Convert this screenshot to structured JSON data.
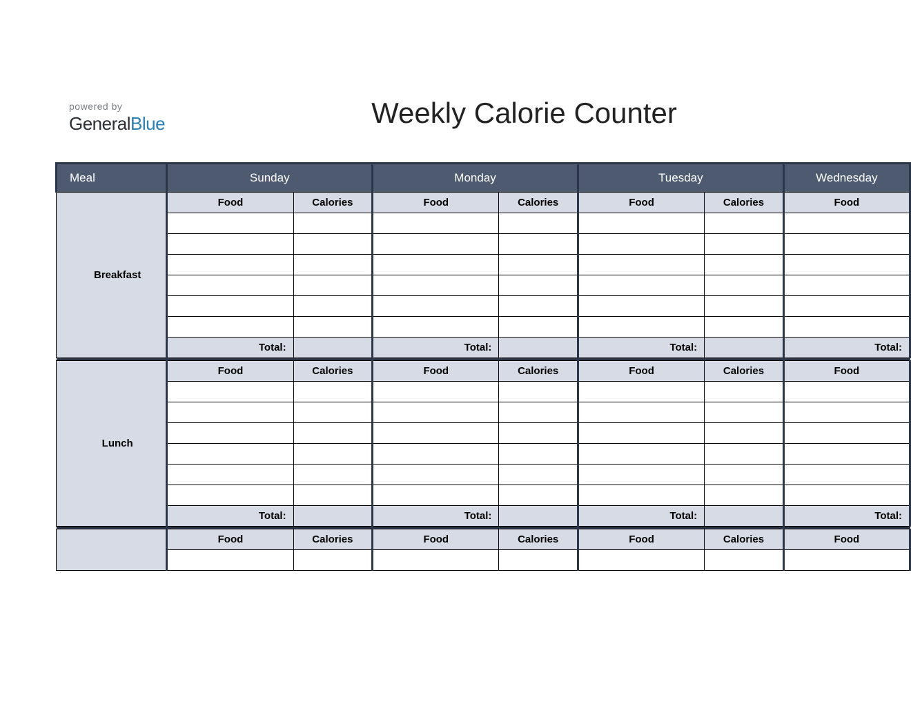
{
  "branding": {
    "powered_by": "powered by",
    "logo_part1": "General",
    "logo_part2": "Blue"
  },
  "title": "Weekly Calorie Counter",
  "header": {
    "meal": "Meal",
    "days": [
      "Sunday",
      "Monday",
      "Tuesday",
      "Wednesday"
    ]
  },
  "subheader": {
    "food": "Food",
    "calories": "Calories",
    "total": "Total:"
  },
  "meals": [
    "Breakfast",
    "Lunch"
  ],
  "entry_rows_per_meal": 6
}
